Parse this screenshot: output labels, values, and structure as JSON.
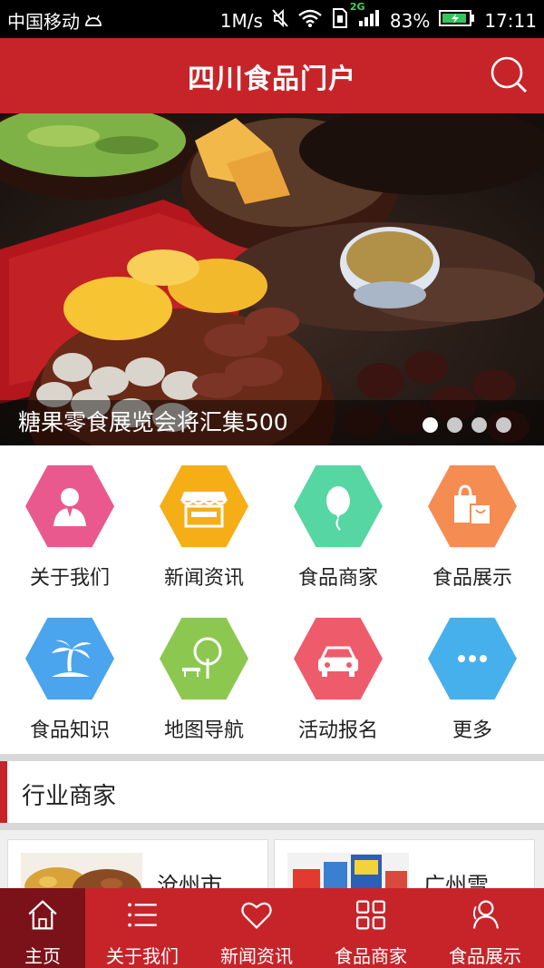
{
  "status_bar": {
    "carrier": "中国移动",
    "speed": "1M/s",
    "network": "2G",
    "battery": "83%",
    "time": "17:11"
  },
  "header": {
    "title": "四川食品门户"
  },
  "banner": {
    "caption": "糖果零食展览会将汇集500",
    "slides_total": 4,
    "active_slide": 1
  },
  "grid": [
    {
      "label": "关于我们",
      "icon": "person-icon",
      "color": "#e9598e"
    },
    {
      "label": "新闻资讯",
      "icon": "storefront-icon",
      "color": "#f6ae17"
    },
    {
      "label": "食品商家",
      "icon": "balloon-icon",
      "color": "#56d6a3"
    },
    {
      "label": "食品展示",
      "icon": "shopping-bags-icon",
      "color": "#f58c52"
    },
    {
      "label": "食品知识",
      "icon": "palm-island-icon",
      "color": "#4aa4ee"
    },
    {
      "label": "地图导航",
      "icon": "tree-bench-icon",
      "color": "#8cc850"
    },
    {
      "label": "活动报名",
      "icon": "car-icon",
      "color": "#ee5b6b"
    },
    {
      "label": "更多",
      "icon": "more-dots-icon",
      "color": "#46b0ec"
    }
  ],
  "section": {
    "title": "行业商家"
  },
  "merchants": [
    {
      "name": "沧州市..."
    },
    {
      "name": "广州雪..."
    }
  ],
  "tabs": [
    {
      "label": "主页",
      "icon": "home-icon",
      "active": true
    },
    {
      "label": "关于我们",
      "icon": "list-icon",
      "active": false
    },
    {
      "label": "新闻资讯",
      "icon": "heart-icon",
      "active": false
    },
    {
      "label": "食品商家",
      "icon": "grid-icon",
      "active": false
    },
    {
      "label": "食品展示",
      "icon": "users-icon",
      "active": false
    }
  ]
}
